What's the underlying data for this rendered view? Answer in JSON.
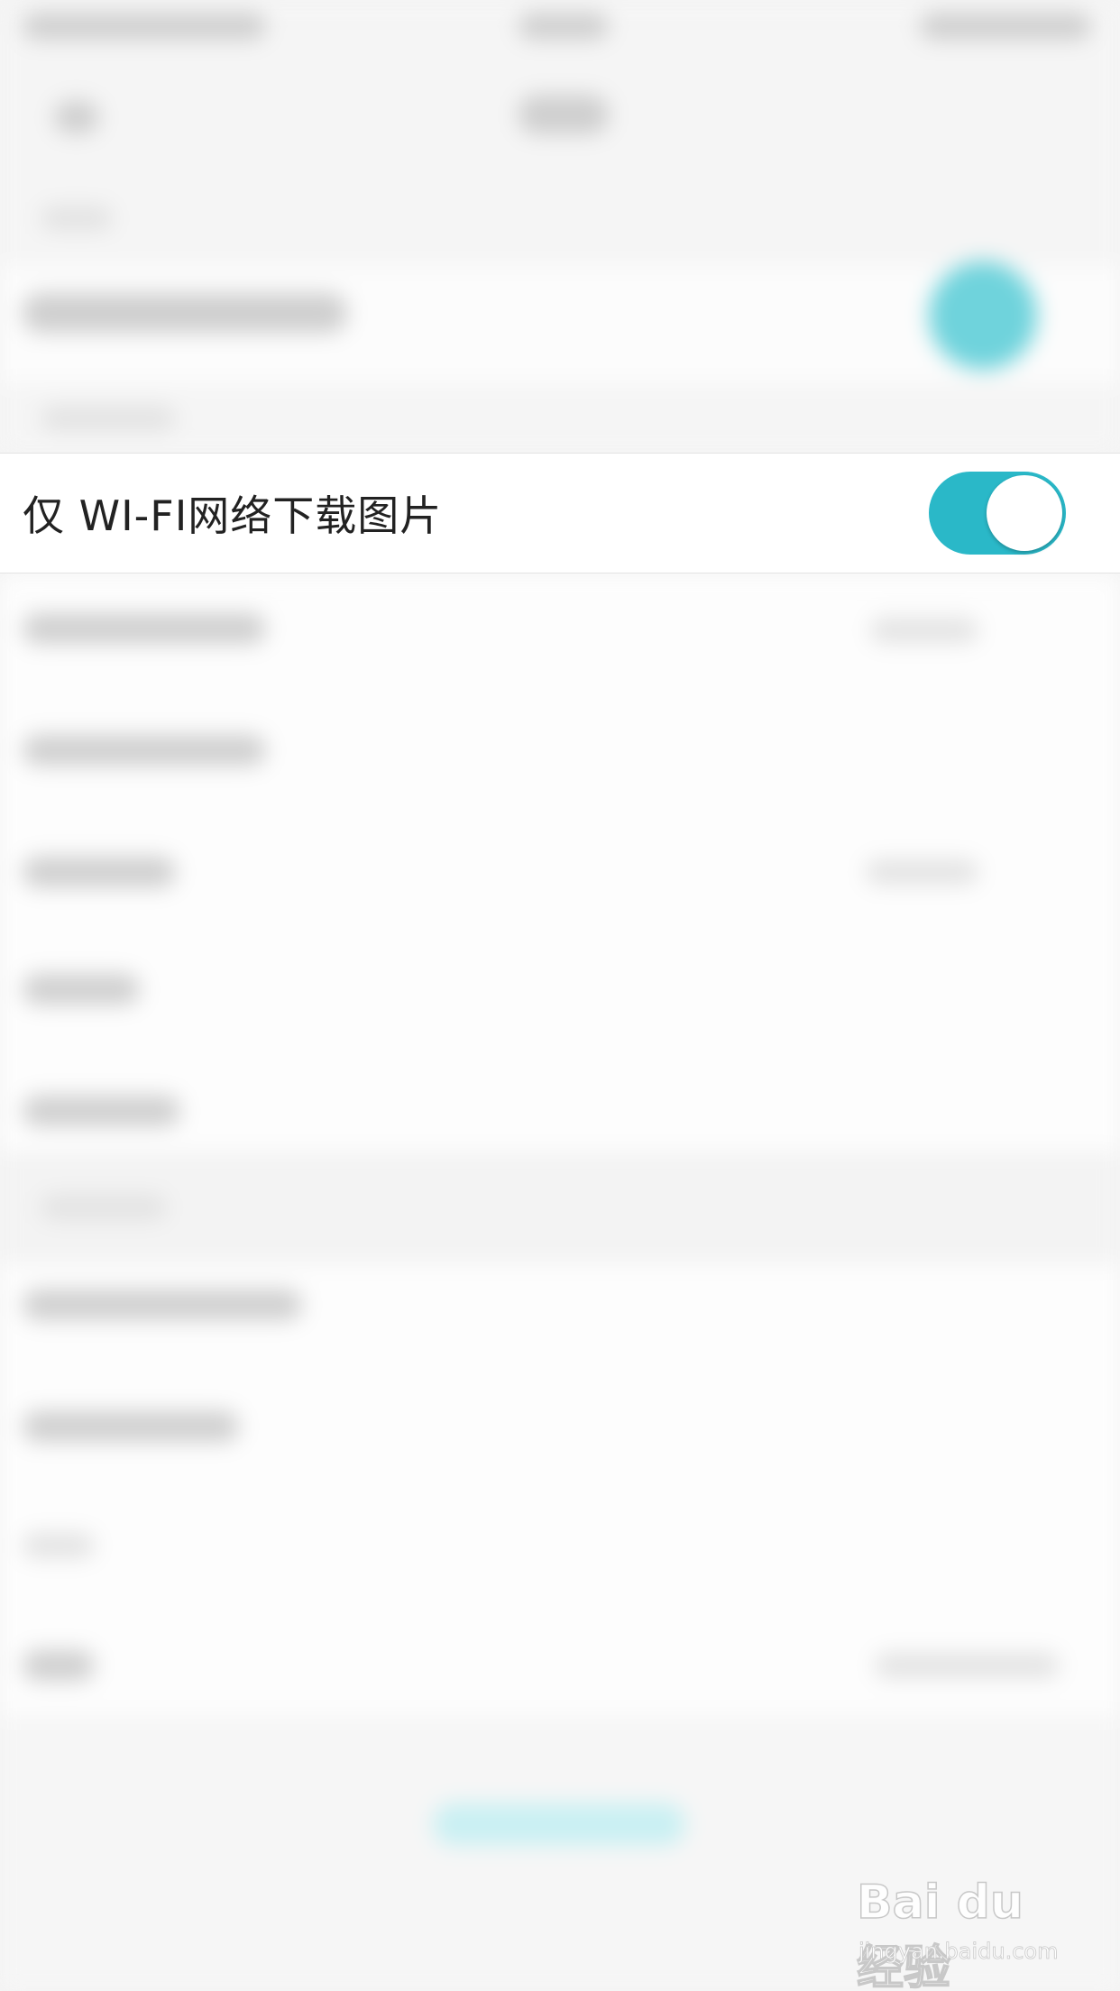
{
  "setting_row": {
    "label": "仅 WI-FI网络下载图片",
    "toggle_on": true
  },
  "colors": {
    "toggle_accent": "#2ab8c8"
  },
  "watermark": {
    "brand": "Bai du 经验",
    "url": "jingyan.baidu.com"
  }
}
